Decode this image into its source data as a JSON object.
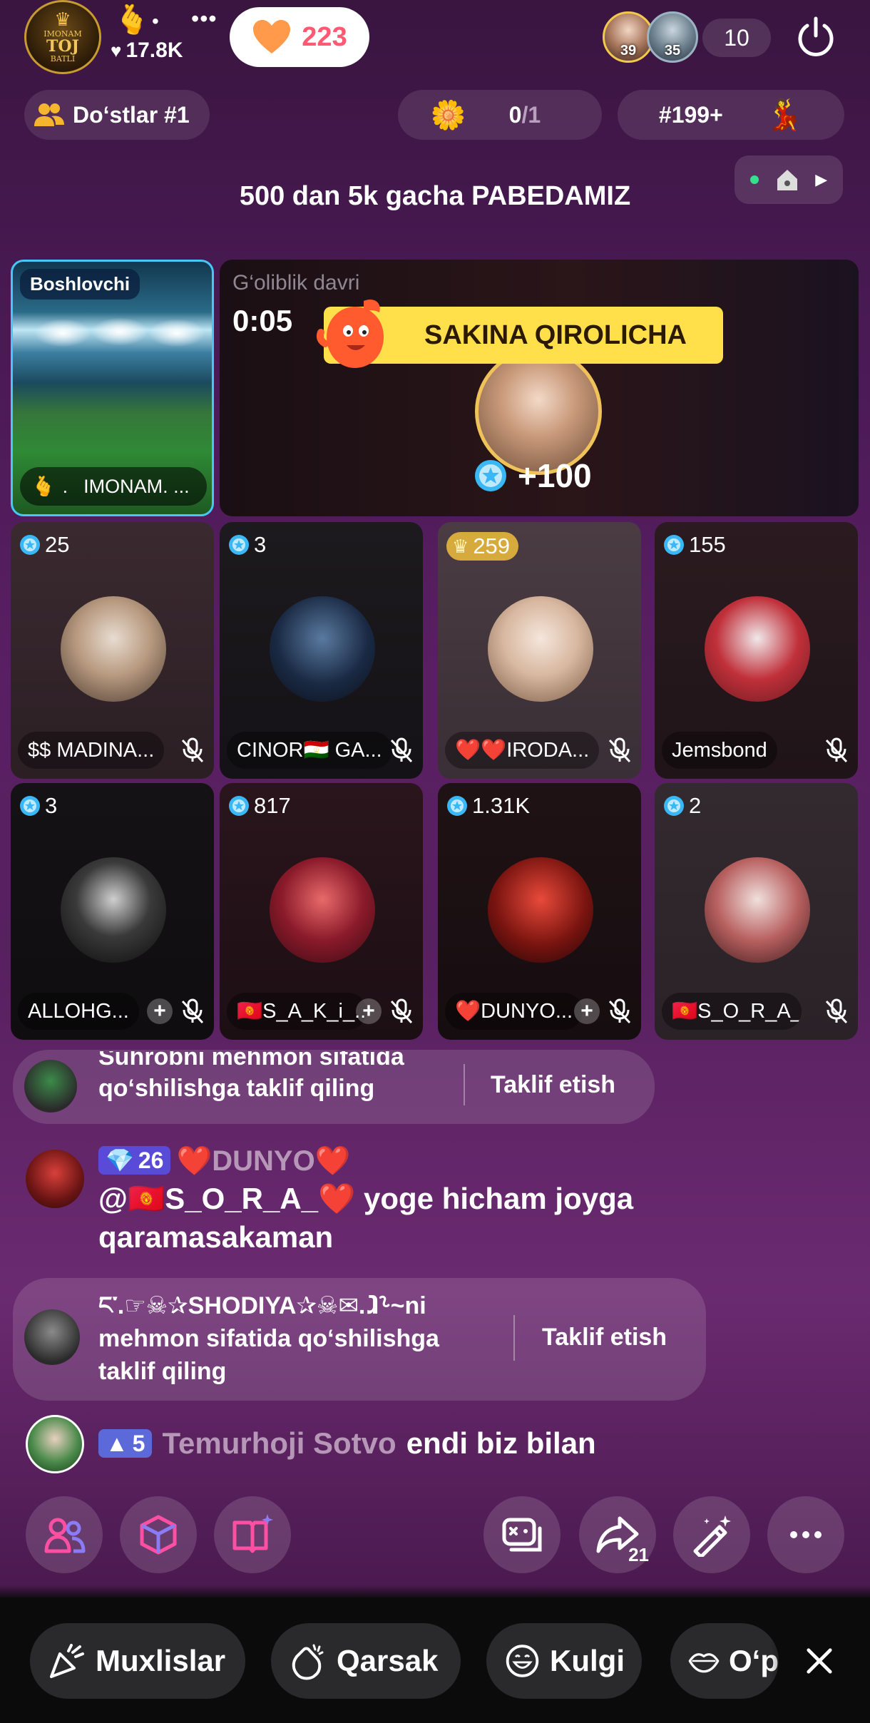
{
  "host": {
    "avatar_text": [
      "IMONAM",
      "TOJ",
      "BATLI"
    ],
    "likes": "17.8K",
    "hearts": "223"
  },
  "viewers": {
    "avatars": [
      {
        "badge": "39"
      },
      {
        "badge": "35"
      }
    ],
    "count": "10"
  },
  "bar2": {
    "friends_label": "Do‘stlar #1",
    "goal_current": "0",
    "goal_total": "/1",
    "rank": "#199+"
  },
  "room_title": "500 dan 5k gacha PABEDAMIZ",
  "leader": {
    "label": "Boshlovchi",
    "name": "IMONAM. ..."
  },
  "winner": {
    "period_label": "G‘oliblik davri",
    "timer": "0:05",
    "banner": "SAKINA QIROLICHA",
    "score": "+100"
  },
  "seats": [
    {
      "score": "25",
      "name": "$$ MADINA...",
      "crown": false
    },
    {
      "score": "3",
      "name": "CINOR🇹🇯 GA...",
      "crown": false
    },
    {
      "score": "259",
      "name": "❤️❤️IRODA...",
      "crown": true
    },
    {
      "score": "155",
      "name": "Jemsbond",
      "crown": false
    },
    {
      "score": "3",
      "name": "ALLOHG...",
      "crown": false
    },
    {
      "score": "817",
      "name": "🇰🇬S_A_K_i_...",
      "crown": false
    },
    {
      "score": "1.31K",
      "name": "❤️DUNYO...",
      "crown": false
    },
    {
      "score": "2",
      "name": "🇰🇬S_O_R_A_...",
      "crown": false
    }
  ],
  "chat": {
    "invite1": {
      "text_line1": "Suhrobni mehmon sifatida",
      "text_line2": "qo‘shilishga taklif qiling",
      "button": "Taklif etish"
    },
    "message1": {
      "level": "26",
      "user": "❤️DUNYO❤️",
      "line1": "@🇰🇬S_O_R_A_❤️ yoge hicham joyga",
      "line2": "qaramasakaman"
    },
    "invite2": {
      "text_line1": "ང་.☞☠✰SHODIYA✰☠✉.ⱹ⸊~ni",
      "text_line2": "mehmon sifatida qo‘shilishga",
      "text_line3": "taklif qiling",
      "button": "Taklif etish"
    },
    "join": {
      "level": "5",
      "user": "Temurhoji Sotvo",
      "text": "endi biz bilan"
    }
  },
  "actions": {
    "share_count": "21"
  },
  "quick_replies": [
    "Muxlislar",
    "Qarsak",
    "Kulgi",
    "O‘p"
  ],
  "colors": {
    "accent_pink": "#ff4fa3",
    "winner_banner": "#ffe04a",
    "gem_blue": "#3ab7f5",
    "crown_gold": "#f0be3c"
  }
}
